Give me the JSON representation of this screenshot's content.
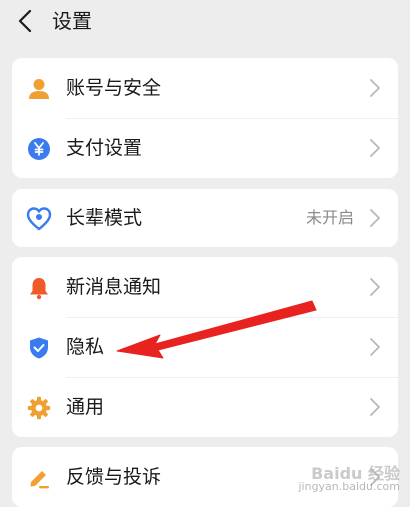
{
  "header": {
    "title": "设置"
  },
  "cards": [
    {
      "items": [
        {
          "name": "account-security",
          "label": "账号与安全",
          "icon": "person-icon"
        },
        {
          "name": "payment-settings",
          "label": "支付设置",
          "icon": "yen-icon"
        }
      ]
    },
    {
      "items": [
        {
          "name": "elder-mode",
          "label": "长辈模式",
          "value": "未开启",
          "icon": "heart-icon"
        }
      ]
    },
    {
      "items": [
        {
          "name": "notifications",
          "label": "新消息通知",
          "icon": "bell-icon"
        },
        {
          "name": "privacy",
          "label": "隐私",
          "icon": "shield-icon"
        },
        {
          "name": "general",
          "label": "通用",
          "icon": "gear-icon"
        }
      ]
    },
    {
      "items": [
        {
          "name": "feedback",
          "label": "反馈与投诉",
          "icon": "pencil-icon"
        }
      ]
    }
  ],
  "colors": {
    "background": "#ededed",
    "card": "#ffffff",
    "orange": "#f0a030",
    "blue": "#3a7bf0",
    "arrow": "#e8221f"
  },
  "watermark": {
    "line1": "Baidu 经验",
    "line2": "jingyan.baidu.com"
  }
}
